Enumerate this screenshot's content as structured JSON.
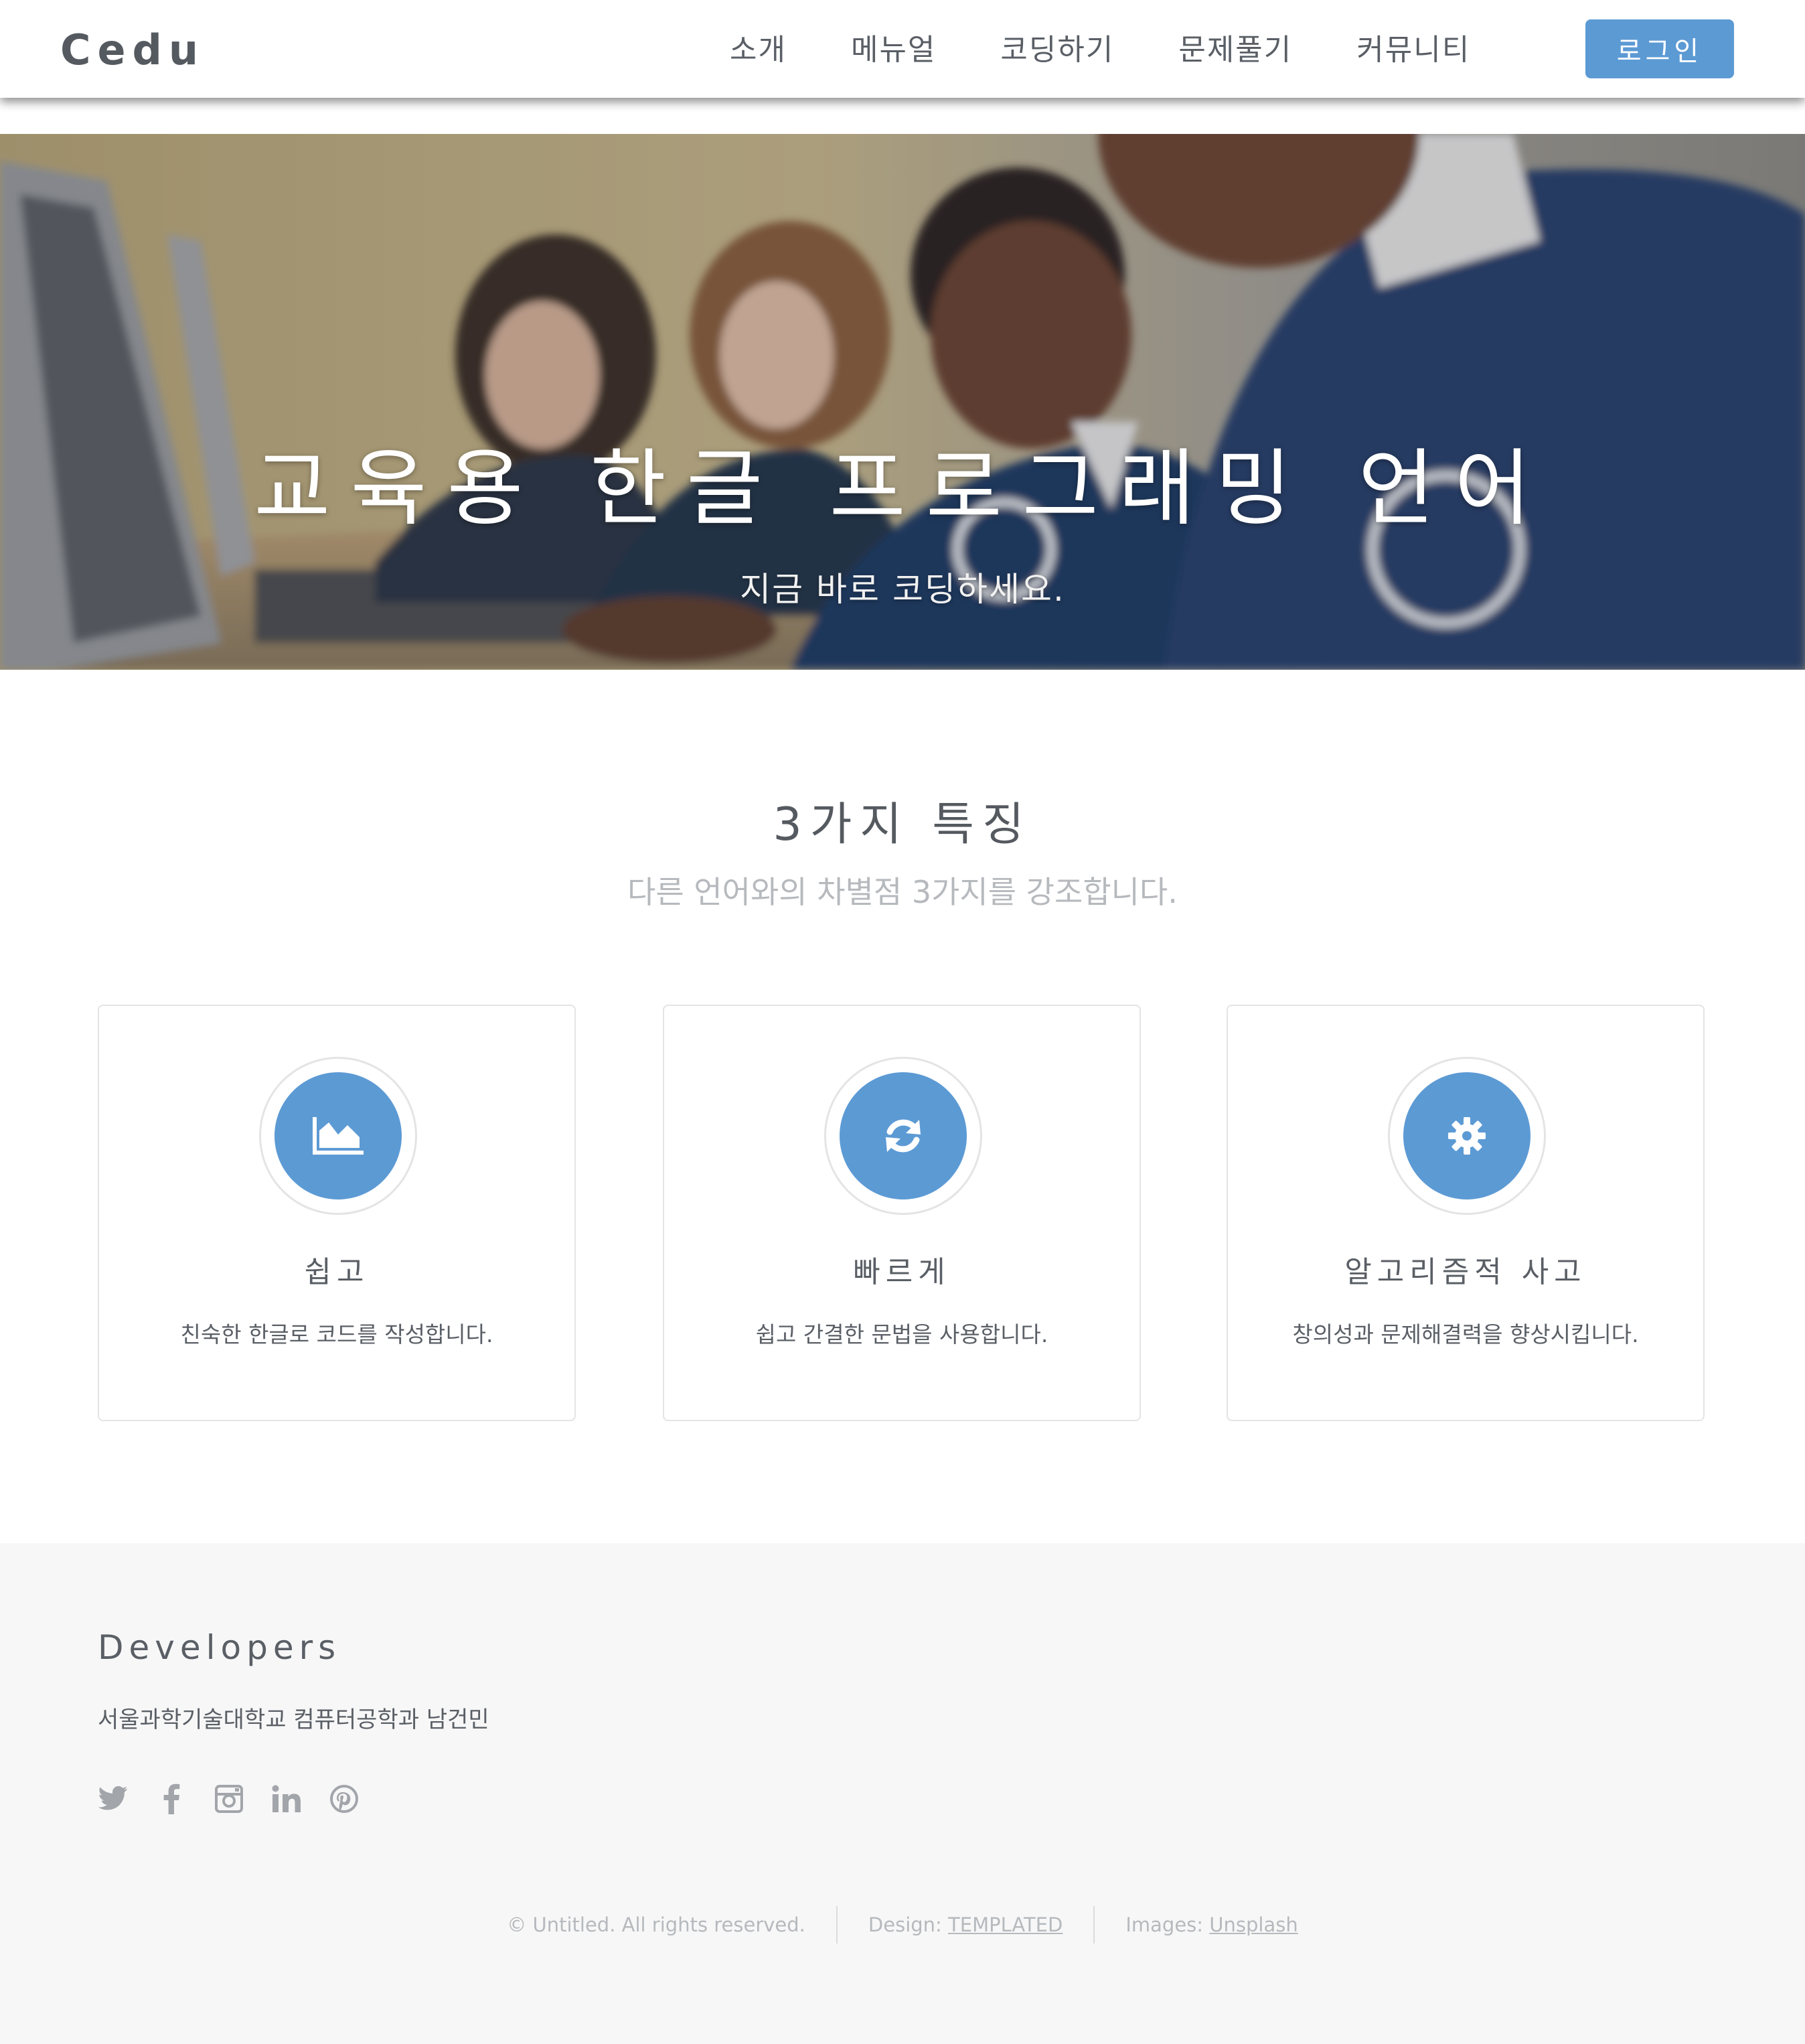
{
  "header": {
    "logo": "Cedu",
    "nav": [
      "소개",
      "메뉴얼",
      "코딩하기",
      "문제풀기",
      "커뮤니티"
    ],
    "login_label": "로그인"
  },
  "hero": {
    "title": "교육용 한글 프로그래밍 언어",
    "subtitle": "지금 바로 코딩하세요."
  },
  "features": {
    "title": "3가지 특징",
    "subtitle": "다른 언어와의 차별점 3가지를 강조합니다.",
    "cards": [
      {
        "icon": "area-chart-icon",
        "title": "쉽고",
        "desc": "친숙한 한글로 코드를 작성합니다."
      },
      {
        "icon": "refresh-icon",
        "title": "빠르게",
        "desc": "쉽고 간결한 문법을 사용합니다."
      },
      {
        "icon": "gear-icon",
        "title": "알고리즘적 사고",
        "desc": "창의성과 문제해결력을 향상시킵니다."
      }
    ]
  },
  "footer": {
    "heading": "Developers",
    "text": "서울과학기술대학교 컴퓨터공학과 남건민",
    "social": [
      "twitter-icon",
      "facebook-icon",
      "instagram-icon",
      "linkedin-icon",
      "pinterest-icon"
    ],
    "copyright": "© Untitled. All rights reserved.",
    "design_label": "Design: ",
    "design_link": "TEMPLATED",
    "images_label": "Images: ",
    "images_link": "Unsplash"
  },
  "colors": {
    "accent": "#5c9ad4",
    "text": "#5a5f66",
    "muted": "#b6b9bd",
    "footer_bg": "#f7f7f7"
  }
}
